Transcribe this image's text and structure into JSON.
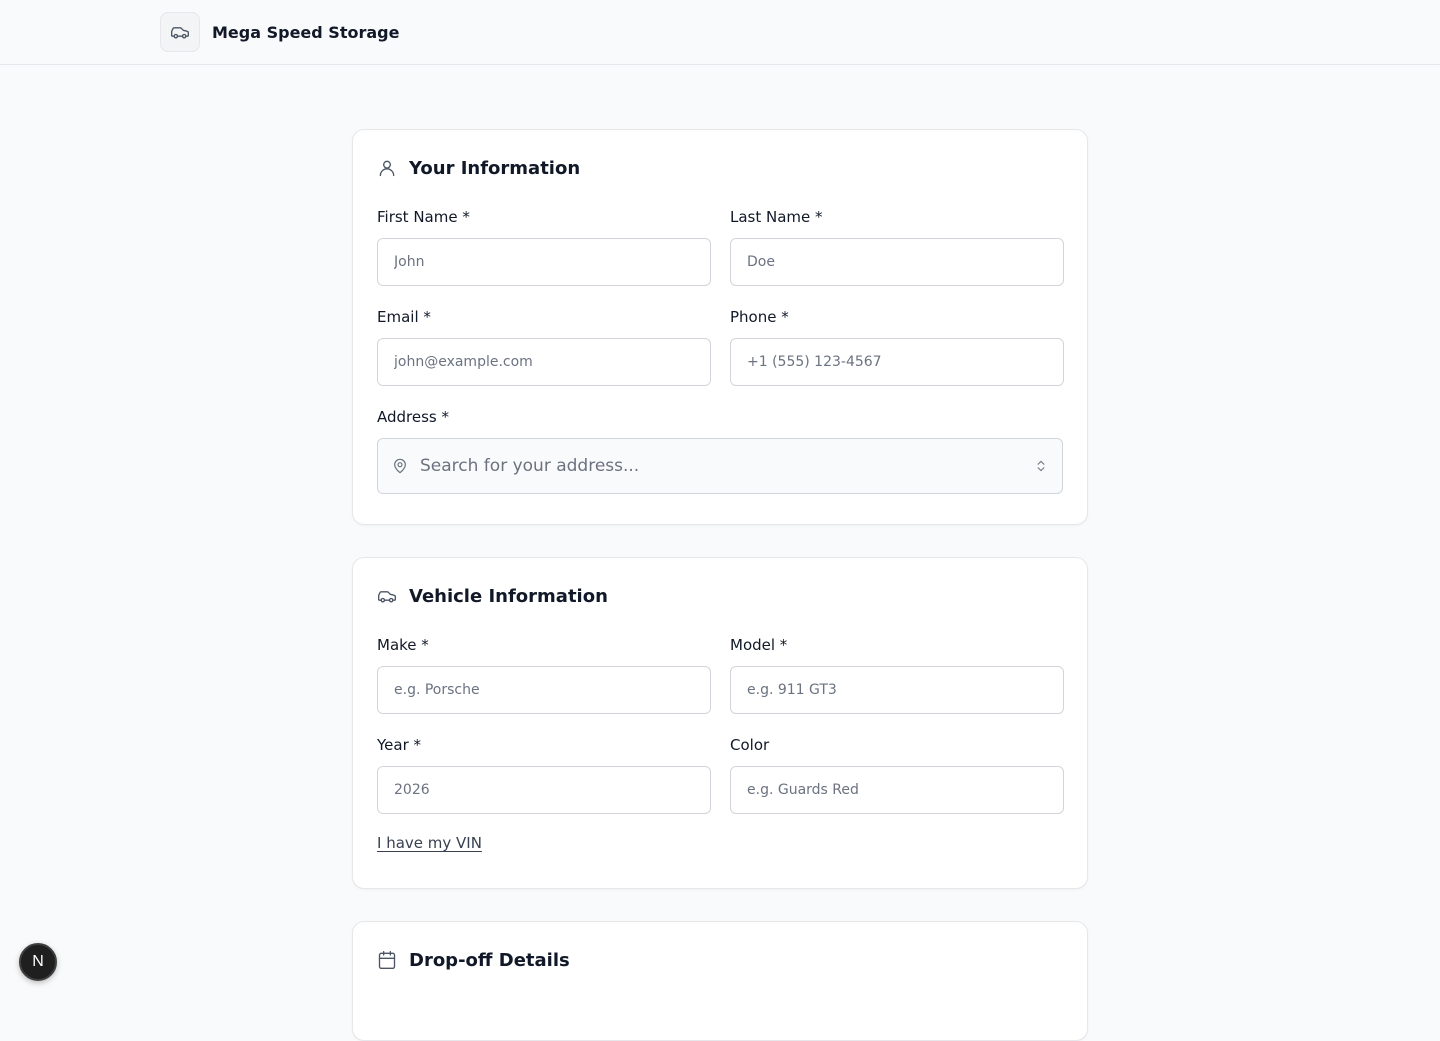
{
  "header": {
    "app_name": "Mega Speed Storage",
    "logo_icon": "car-icon"
  },
  "personal": {
    "title": "Your Information",
    "icon": "user-icon",
    "first_name": {
      "label": "First Name *",
      "placeholder": "John",
      "value": ""
    },
    "last_name": {
      "label": "Last Name *",
      "placeholder": "Doe",
      "value": ""
    },
    "email": {
      "label": "Email *",
      "placeholder": "john@example.com",
      "value": ""
    },
    "phone": {
      "label": "Phone *",
      "placeholder": "+1 (555) 123-4567",
      "value": ""
    },
    "address": {
      "label": "Address *",
      "placeholder": "Search for your address...",
      "icon": "map-pin-icon"
    }
  },
  "vehicle": {
    "title": "Vehicle Information",
    "icon": "car-icon",
    "make": {
      "label": "Make *",
      "placeholder": "e.g. Porsche",
      "value": ""
    },
    "model": {
      "label": "Model *",
      "placeholder": "e.g. 911 GT3",
      "value": ""
    },
    "year": {
      "label": "Year *",
      "placeholder": "2026",
      "value": ""
    },
    "color": {
      "label": "Color",
      "placeholder": "e.g. Guards Red",
      "value": ""
    },
    "vin_link": "I have my VIN"
  },
  "dropoff": {
    "title": "Drop-off Details",
    "icon": "calendar-icon"
  },
  "dev_badge": {
    "label": "N"
  },
  "colors": {
    "background": "#f9fafb",
    "card": "#ffffff",
    "border": "#e5e7eb",
    "text": "#111827",
    "muted": "#6b7280"
  }
}
